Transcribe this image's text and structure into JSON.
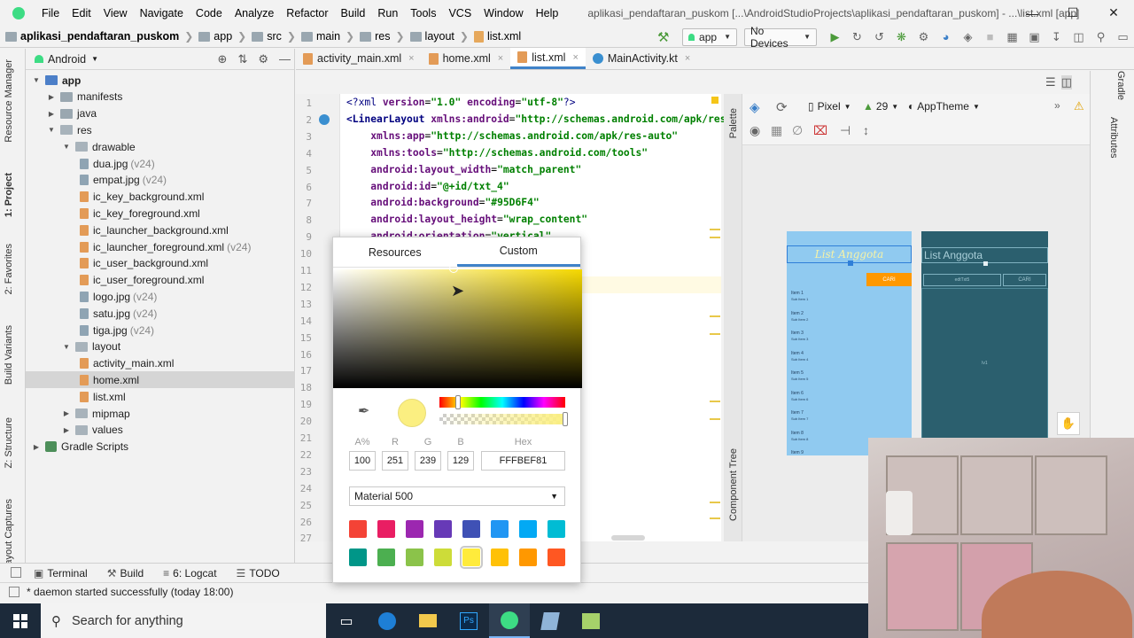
{
  "menu": [
    "File",
    "Edit",
    "View",
    "Navigate",
    "Code",
    "Analyze",
    "Refactor",
    "Build",
    "Run",
    "Tools",
    "VCS",
    "Window",
    "Help"
  ],
  "window_title": "aplikasi_pendaftaran_puskom [...\\AndroidStudioProjects\\aplikasi_pendaftaran_puskom] - ...\\list.xml [app]",
  "breadcrumb": [
    "aplikasi_pendaftaran_puskom",
    "app",
    "src",
    "main",
    "res",
    "layout",
    "list.xml"
  ],
  "toolbar": {
    "module": "app",
    "devices": "No Devices"
  },
  "left_tabs": [
    "Resource Manager",
    "1: Project",
    "2: Favorites",
    "Build Variants",
    "Z: Structure",
    "Layout Captures"
  ],
  "project": {
    "view": "Android",
    "tree": [
      {
        "label": "app",
        "kind": "app",
        "depth": 0,
        "arrow": "▼"
      },
      {
        "label": "manifests",
        "kind": "folder",
        "depth": 1,
        "arrow": "▶"
      },
      {
        "label": "java",
        "kind": "folder",
        "depth": 1,
        "arrow": "▶"
      },
      {
        "label": "res",
        "kind": "res",
        "depth": 1,
        "arrow": "▼"
      },
      {
        "label": "drawable",
        "kind": "res",
        "depth": 2,
        "arrow": "▼"
      },
      {
        "label": "dua.jpg",
        "kind": "img",
        "depth": 3,
        "ver": "(v24)"
      },
      {
        "label": "empat.jpg",
        "kind": "img",
        "depth": 3,
        "ver": "(v24)"
      },
      {
        "label": "ic_key_background.xml",
        "kind": "xml",
        "depth": 3
      },
      {
        "label": "ic_key_foreground.xml",
        "kind": "xml",
        "depth": 3
      },
      {
        "label": "ic_launcher_background.xml",
        "kind": "xml",
        "depth": 3
      },
      {
        "label": "ic_launcher_foreground.xml",
        "kind": "xml",
        "depth": 3,
        "ver": "(v24)"
      },
      {
        "label": "ic_user_background.xml",
        "kind": "xml",
        "depth": 3
      },
      {
        "label": "ic_user_foreground.xml",
        "kind": "xml",
        "depth": 3
      },
      {
        "label": "logo.jpg",
        "kind": "img",
        "depth": 3,
        "ver": "(v24)"
      },
      {
        "label": "satu.jpg",
        "kind": "img",
        "depth": 3,
        "ver": "(v24)"
      },
      {
        "label": "tiga.jpg",
        "kind": "img",
        "depth": 3,
        "ver": "(v24)"
      },
      {
        "label": "layout",
        "kind": "res",
        "depth": 2,
        "arrow": "▼"
      },
      {
        "label": "activity_main.xml",
        "kind": "xml",
        "depth": 3
      },
      {
        "label": "home.xml",
        "kind": "xml",
        "depth": 3,
        "selected": true
      },
      {
        "label": "list.xml",
        "kind": "xml",
        "depth": 3
      },
      {
        "label": "mipmap",
        "kind": "res",
        "depth": 2,
        "arrow": "▶"
      },
      {
        "label": "values",
        "kind": "res",
        "depth": 2,
        "arrow": "▶"
      },
      {
        "label": "Gradle Scripts",
        "kind": "gradle",
        "depth": 0,
        "arrow": "▶"
      }
    ]
  },
  "tabs": [
    {
      "label": "activity_main.xml",
      "kind": "xml"
    },
    {
      "label": "home.xml",
      "kind": "xml"
    },
    {
      "label": "list.xml",
      "kind": "xml",
      "active": true
    },
    {
      "label": "MainActivity.kt",
      "kind": "kt"
    }
  ],
  "code_lines": [
    {
      "n": "1",
      "text": "<?xml version=\"1.0\" encoding=\"utf-8\"?>"
    },
    {
      "n": "2",
      "text": "<LinearLayout xmlns:android=\"http://schemas.android.com/apk/res/a"
    },
    {
      "n": "3",
      "text": "    xmlns:app=\"http://schemas.android.com/apk/res-auto\""
    },
    {
      "n": "4",
      "text": "    xmlns:tools=\"http://schemas.android.com/tools\""
    },
    {
      "n": "5",
      "text": "    android:layout_width=\"match_parent\""
    },
    {
      "n": "6",
      "text": "    android:id=\"@+id/txt_4\""
    },
    {
      "n": "7",
      "text": "    android:background=\"#95D6F4\""
    },
    {
      "n": "8",
      "text": "    android:layout_height=\"wrap_content\""
    },
    {
      "n": "9",
      "text": "    android:orientation=\"vertical\""
    },
    {
      "n": "10",
      "text": ""
    },
    {
      "n": "11",
      "text": ""
    },
    {
      "n": "12",
      "text": ""
    },
    {
      "n": "13",
      "text": ""
    },
    {
      "n": "14",
      "text": "                                 nt\""
    },
    {
      "n": "15",
      "text": "                                 ent\""
    },
    {
      "n": "16",
      "text": ""
    },
    {
      "n": "17",
      "text": ""
    },
    {
      "n": "18",
      "text": ""
    },
    {
      "n": "19",
      "text": ""
    },
    {
      "n": "20",
      "text": ""
    },
    {
      "n": "21",
      "text": ""
    },
    {
      "n": "22",
      "text": ""
    },
    {
      "n": "23",
      "text": ""
    },
    {
      "n": "24",
      "text": ""
    },
    {
      "n": "25",
      "text": "                                 nt\""
    },
    {
      "n": "26",
      "text": "                                 ent\""
    },
    {
      "n": "27",
      "text": ""
    }
  ],
  "design": {
    "device": "Pixel",
    "api": "29",
    "theme": "AppTheme",
    "palette_label": "Palette",
    "tree_label": "Component Tree",
    "right_labels": [
      "Gradle",
      "Attributes"
    ],
    "phone1": {
      "title": "List Anggota",
      "button": "CARI",
      "items": [
        {
          "title": "Item 1",
          "sub": "Sub Item 1"
        },
        {
          "title": "Item 2",
          "sub": "Sub Item 2"
        },
        {
          "title": "Item 3",
          "sub": "Sub Item 3"
        },
        {
          "title": "Item 4",
          "sub": "Sub Item 4"
        },
        {
          "title": "Item 5",
          "sub": "Sub Item 5"
        },
        {
          "title": "Item 6",
          "sub": "Sub Item 6"
        },
        {
          "title": "Item 7",
          "sub": "Sub Item 7"
        },
        {
          "title": "Item 8",
          "sub": "Sub Item 8"
        },
        {
          "title": "Item 9",
          "sub": ""
        }
      ]
    },
    "phone2": {
      "title": "List Anggota",
      "input": "edtTxt5",
      "button": "CARI",
      "center": "lv1"
    }
  },
  "picker": {
    "tabs": [
      "Resources",
      "Custom"
    ],
    "active_tab": "Custom",
    "labels": [
      "A%",
      "R",
      "G",
      "B",
      "Hex"
    ],
    "values": [
      "100",
      "251",
      "239",
      "129",
      "FFFBEF81"
    ],
    "palette_name": "Material 500",
    "selected_color": "#fbef81",
    "swatches": [
      "#f44336",
      "#e91e63",
      "#9c27b0",
      "#673ab7",
      "#3f51b5",
      "#2196f3",
      "#03a9f4",
      "#00bcd4",
      "#009688",
      "#4caf50",
      "#8bc34a",
      "#cddc39",
      "#ffeb3b",
      "#ffc107",
      "#ff9800",
      "#ff5722"
    ],
    "selected_swatch": 12
  },
  "bottom_tabs": [
    {
      "label": "Terminal",
      "icon": "terminal-icon"
    },
    {
      "label": "Build",
      "icon": "hammer-icon"
    },
    {
      "label": "6: Logcat",
      "icon": "logcat-icon"
    },
    {
      "label": "TODO",
      "icon": "todo-icon"
    }
  ],
  "status": "* daemon started successfully (today 18:00)",
  "taskbar": {
    "search": "Search for anything"
  }
}
